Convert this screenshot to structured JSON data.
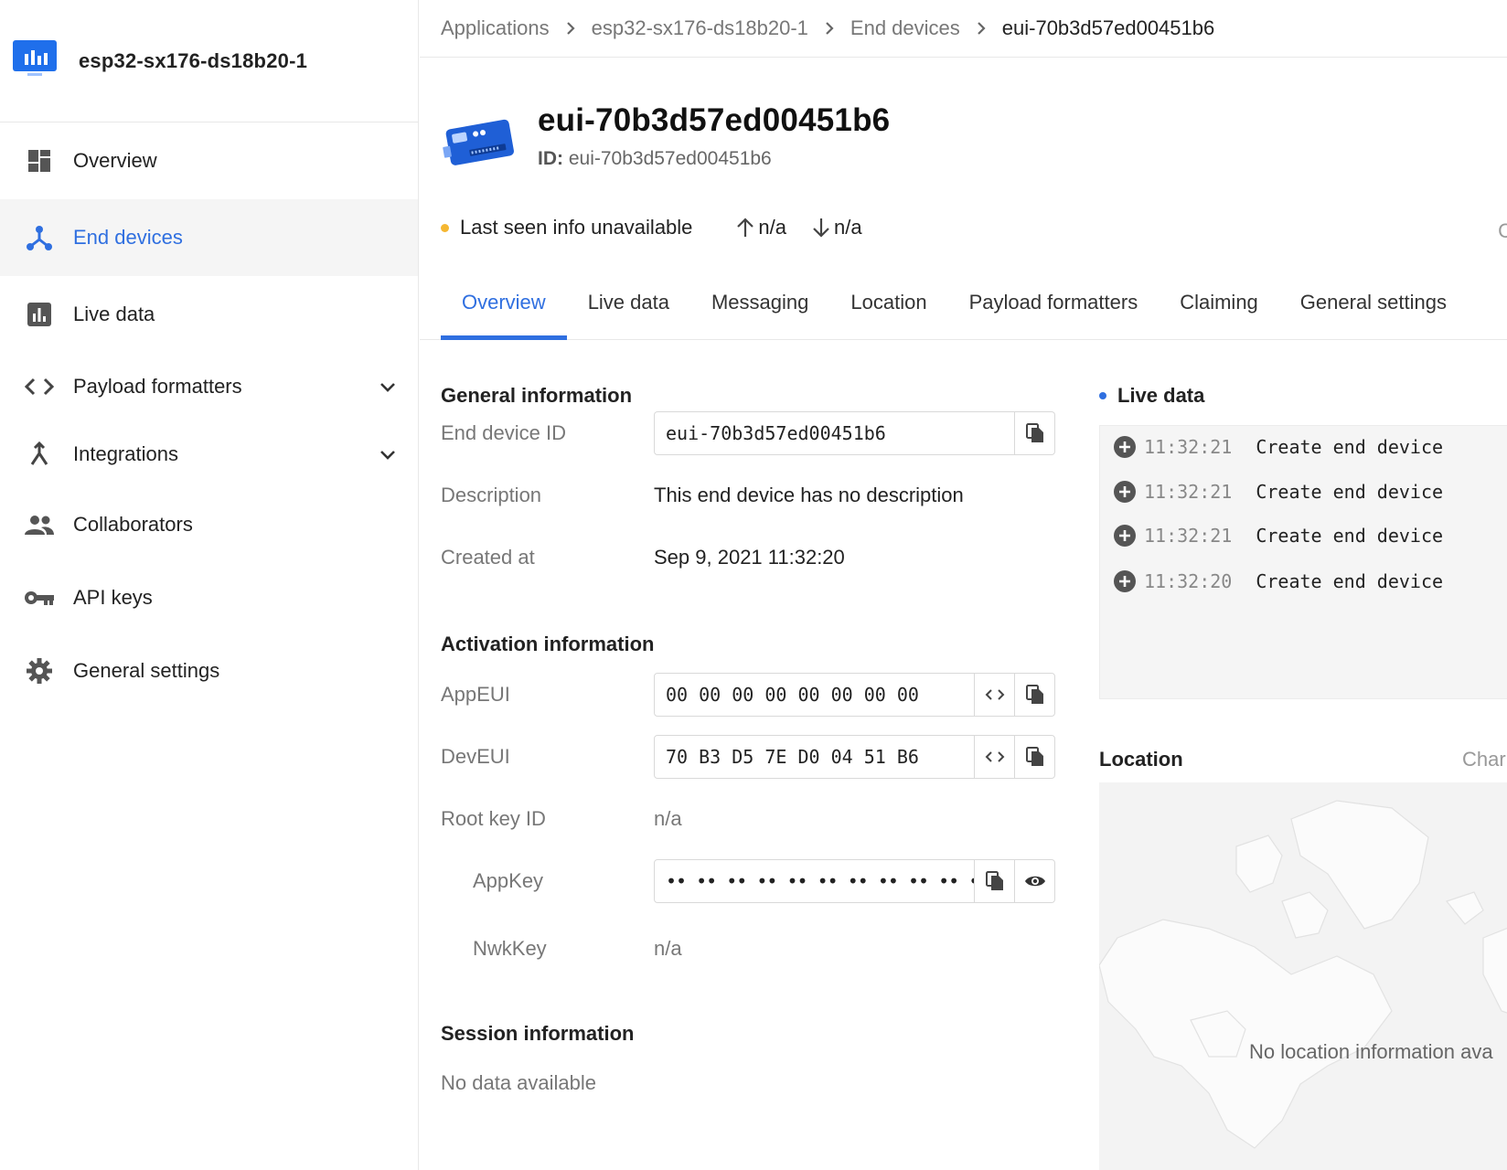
{
  "app": {
    "name": "esp32-sx176-ds18b20-1"
  },
  "sidebar": {
    "items": [
      {
        "label": "Overview",
        "icon": "dashboard-icon"
      },
      {
        "label": "End devices",
        "icon": "end-devices-icon"
      },
      {
        "label": "Live data",
        "icon": "bar-chart-icon"
      },
      {
        "label": "Payload formatters",
        "icon": "code-icon"
      },
      {
        "label": "Integrations",
        "icon": "merge-icon"
      },
      {
        "label": "Collaborators",
        "icon": "people-icon"
      },
      {
        "label": "API keys",
        "icon": "key-icon"
      },
      {
        "label": "General settings",
        "icon": "gear-icon"
      }
    ]
  },
  "breadcrumb": [
    "Applications",
    "esp32-sx176-ds18b20-1",
    "End devices",
    "eui-70b3d57ed00451b6"
  ],
  "device": {
    "title": "eui-70b3d57ed00451b6",
    "id_label": "ID:",
    "id_value": "eui-70b3d57ed00451b6",
    "last_seen": "Last seen info unavailable",
    "uplink": "n/a",
    "downlink": "n/a",
    "status_right": "C"
  },
  "tabs": [
    "Overview",
    "Live data",
    "Messaging",
    "Location",
    "Payload formatters",
    "Claiming",
    "General settings"
  ],
  "general": {
    "title": "General information",
    "end_device_id_label": "End device ID",
    "end_device_id": "eui-70b3d57ed00451b6",
    "description_label": "Description",
    "description": "This end device has no description",
    "created_label": "Created at",
    "created": "Sep 9, 2021 11:32:20"
  },
  "activation": {
    "title": "Activation information",
    "appeui_label": "AppEUI",
    "appeui": "00 00 00 00 00 00 00 00",
    "deveui_label": "DevEUI",
    "deveui": "70 B3 D5 7E D0 04 51 B6",
    "root_key_label": "Root key ID",
    "root_key": "n/a",
    "appkey_label": "AppKey",
    "appkey": "•• •• •• •• •• •• •• •• •• •• •• ••",
    "nwkkey_label": "NwkKey",
    "nwkkey": "n/a"
  },
  "session": {
    "title": "Session information",
    "empty": "No data available"
  },
  "live": {
    "title": "Live data",
    "events": [
      {
        "time": "11:32:21",
        "event": "Create end device"
      },
      {
        "time": "11:32:21",
        "event": "Create end device"
      },
      {
        "time": "11:32:21",
        "event": "Create end device"
      },
      {
        "time": "11:32:20",
        "event": "Create end device"
      }
    ]
  },
  "location": {
    "title": "Location",
    "change_label": "Char",
    "empty": "No location information ava"
  },
  "colors": {
    "accent": "#2f6fe0",
    "status_warning": "#f5b731"
  }
}
